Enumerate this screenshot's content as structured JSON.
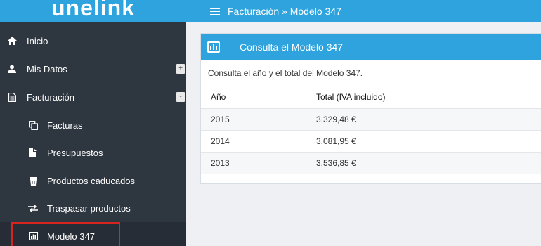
{
  "brand": "unelink",
  "topbar": {
    "breadcrumb": "Facturación » Modelo 347",
    "menu_icon": "hamburger-icon"
  },
  "sidebar": {
    "items": [
      {
        "label": "Inicio",
        "icon": "home-icon"
      },
      {
        "label": "Mis Datos",
        "icon": "user-icon",
        "toggle": "+"
      },
      {
        "label": "Facturación",
        "icon": "document-icon",
        "toggle": "-"
      },
      {
        "label": "Facturas",
        "icon": "copy-icon"
      },
      {
        "label": "Presupuestos",
        "icon": "file-icon"
      },
      {
        "label": "Productos caducados",
        "icon": "trash-icon"
      },
      {
        "label": "Traspasar productos",
        "icon": "transfer-icon"
      },
      {
        "label": "Modelo 347",
        "icon": "bar-chart-icon"
      }
    ]
  },
  "panel": {
    "title": "Consulta el Modelo 347",
    "description": "Consulta el año y el total del Modelo 347.",
    "columns": [
      "Año",
      "Total (IVA incluido)"
    ],
    "rows": [
      {
        "year": "2015",
        "total": "3.329,48 €"
      },
      {
        "year": "2014",
        "total": "3.081,95 €"
      },
      {
        "year": "2013",
        "total": "3.536,85 €"
      }
    ]
  },
  "colors": {
    "accent": "#2ea3de",
    "sidebar": "#2e3640",
    "highlight": "#d9231e"
  }
}
